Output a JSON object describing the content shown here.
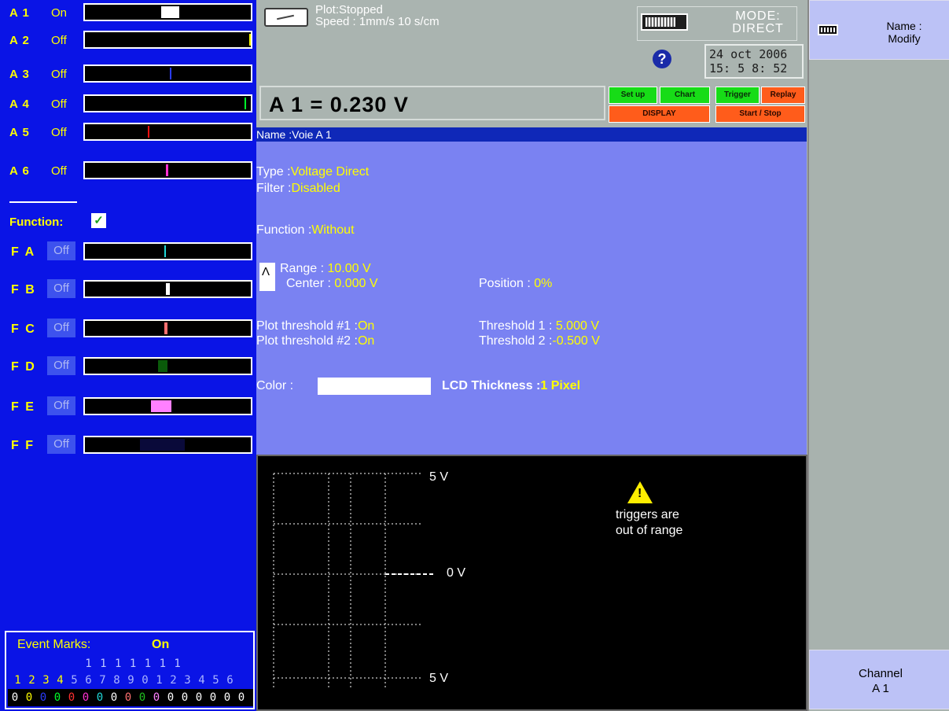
{
  "header": {
    "plot_status": "Plot:Stopped",
    "speed": "Speed : 1mm/s 10 s/cm",
    "mode_label": "MODE:",
    "mode_value": "DIRECT",
    "date": "24 oct 2006",
    "time": "15: 5 8: 52",
    "measure": "A 1 = 0.230  V",
    "buttons": {
      "setup": "Set up",
      "chart": "Chart",
      "trigger": "Trigger",
      "replay": "Replay",
      "display": "DISPLAY",
      "start_stop": "Start / Stop"
    }
  },
  "channels": [
    {
      "name": "A 1",
      "state": "On",
      "marker_color": "#ffffff",
      "marker_pos": 0.46,
      "marker_width": 0.11
    },
    {
      "name": "A 2",
      "state": "Off",
      "marker_color": "#ffff00",
      "marker_pos": 0.99,
      "marker_width": 0.01
    },
    {
      "name": "A 3",
      "state": "Off",
      "marker_color": "#2a3cff",
      "marker_pos": 0.51,
      "marker_width": 0.01
    },
    {
      "name": "A 4",
      "state": "Off",
      "marker_color": "#00ff2a",
      "marker_pos": 0.96,
      "marker_width": 0.01
    },
    {
      "name": "A 5",
      "state": "Off",
      "marker_color": "#ff1010",
      "marker_pos": 0.38,
      "marker_width": 0.01
    },
    {
      "name": "A 6",
      "state": "Off",
      "marker_color": "#ff30d0",
      "marker_pos": 0.49,
      "marker_width": 0.012
    }
  ],
  "functions": {
    "title": "Function:",
    "check": "✓",
    "items": [
      {
        "name": "F A",
        "state": "Off",
        "marker_color": "#20d8d8",
        "marker_pos": 0.48,
        "marker_width": 0.006
      },
      {
        "name": "F B",
        "state": "Off",
        "marker_color": "#ffffff",
        "marker_pos": 0.49,
        "marker_width": 0.02
      },
      {
        "name": "F C",
        "state": "Off",
        "marker_color": "#ff7070",
        "marker_pos": 0.48,
        "marker_width": 0.02
      },
      {
        "name": "F D",
        "state": "Off",
        "marker_color": "#0a5a0a",
        "marker_pos": 0.44,
        "marker_width": 0.06
      },
      {
        "name": "F E",
        "state": "Off",
        "marker_color": "#ff80ff",
        "marker_pos": 0.4,
        "marker_width": 0.12
      },
      {
        "name": "F F",
        "state": "Off",
        "marker_color": "#0a0a3a",
        "marker_pos": 0.33,
        "marker_width": 0.27
      }
    ]
  },
  "event_marks": {
    "title": "Event Marks:",
    "state": "On",
    "tens_row": "          1 1 1 1 1 1 1",
    "units": [
      {
        "d": "1",
        "c": "#ffff00"
      },
      {
        "d": "2",
        "c": "#ffff00"
      },
      {
        "d": "3",
        "c": "#ffff00"
      },
      {
        "d": "4",
        "c": "#ffff00"
      },
      {
        "d": "5",
        "c": "#aab4ff"
      },
      {
        "d": "6",
        "c": "#aab4ff"
      },
      {
        "d": "7",
        "c": "#aab4ff"
      },
      {
        "d": "8",
        "c": "#aab4ff"
      },
      {
        "d": "9",
        "c": "#aab4ff"
      },
      {
        "d": "0",
        "c": "#aab4ff"
      },
      {
        "d": "1",
        "c": "#aab4ff"
      },
      {
        "d": "2",
        "c": "#aab4ff"
      },
      {
        "d": "3",
        "c": "#aab4ff"
      },
      {
        "d": "4",
        "c": "#aab4ff"
      },
      {
        "d": "5",
        "c": "#aab4ff"
      },
      {
        "d": "6",
        "c": "#aab4ff"
      }
    ],
    "zeros": [
      {
        "d": "0",
        "c": "#ffffff"
      },
      {
        "d": "0",
        "c": "#ffff00"
      },
      {
        "d": "0",
        "c": "#2a3cff"
      },
      {
        "d": "0",
        "c": "#00ff2a"
      },
      {
        "d": "0",
        "c": "#ff3030"
      },
      {
        "d": "0",
        "c": "#ff30d0"
      },
      {
        "d": "0",
        "c": "#20d8d8"
      },
      {
        "d": "0",
        "c": "#ffffff"
      },
      {
        "d": "0",
        "c": "#ff7070"
      },
      {
        "d": "0",
        "c": "#20c020"
      },
      {
        "d": "0",
        "c": "#ff80ff"
      },
      {
        "d": "0",
        "c": "#ffffff"
      },
      {
        "d": "0",
        "c": "#ffffff"
      },
      {
        "d": "0",
        "c": "#ffffff"
      },
      {
        "d": "0",
        "c": "#ffffff"
      },
      {
        "d": "0",
        "c": "#ffffff"
      },
      {
        "d": "0",
        "c": "#ffffff"
      }
    ]
  },
  "info": {
    "name_line": "Name :Voie   A 1",
    "type_label": "Type :",
    "type_value": "Voltage Direct",
    "filter_label": "Filter :",
    "filter_value": "Disabled",
    "function_label": "Function :",
    "function_value": "Without",
    "range_label": "Range  :  ",
    "range_value": "10.00 V",
    "center_label": "Center :  ",
    "center_value": "0.000 V",
    "position_label": "Position : ",
    "position_value": "0%",
    "pt1_label": "Plot threshold #1 :",
    "pt1_value": "On",
    "pt2_label": "Plot threshold #2 :",
    "pt2_value": "On",
    "th1_label": "Threshold 1 : ",
    "th1_value": "5.000 V",
    "th2_label": "Threshold 2 :",
    "th2_value": "-0.500 V",
    "color_label": "Color :",
    "color_value": "#ffffff",
    "lcd_label": "LCD Thickness :",
    "lcd_value": "1 Pixel"
  },
  "graph": {
    "top_label": "5 V",
    "mid_label": "0 V",
    "bottom_label": "5 V",
    "warning_line1": "triggers are",
    "warning_line2": "out of range"
  },
  "softkeys": {
    "top_line1": "Name :",
    "top_line2": "Modify",
    "bottom_line1": "Channel",
    "bottom_line2": "A 1"
  },
  "colors": {
    "panel_blue": "#0a14e6",
    "info_blue": "#7a82f2",
    "accent_yellow": "#ffff00",
    "button_green": "#17dc17",
    "button_orange": "#ff5c1b"
  }
}
